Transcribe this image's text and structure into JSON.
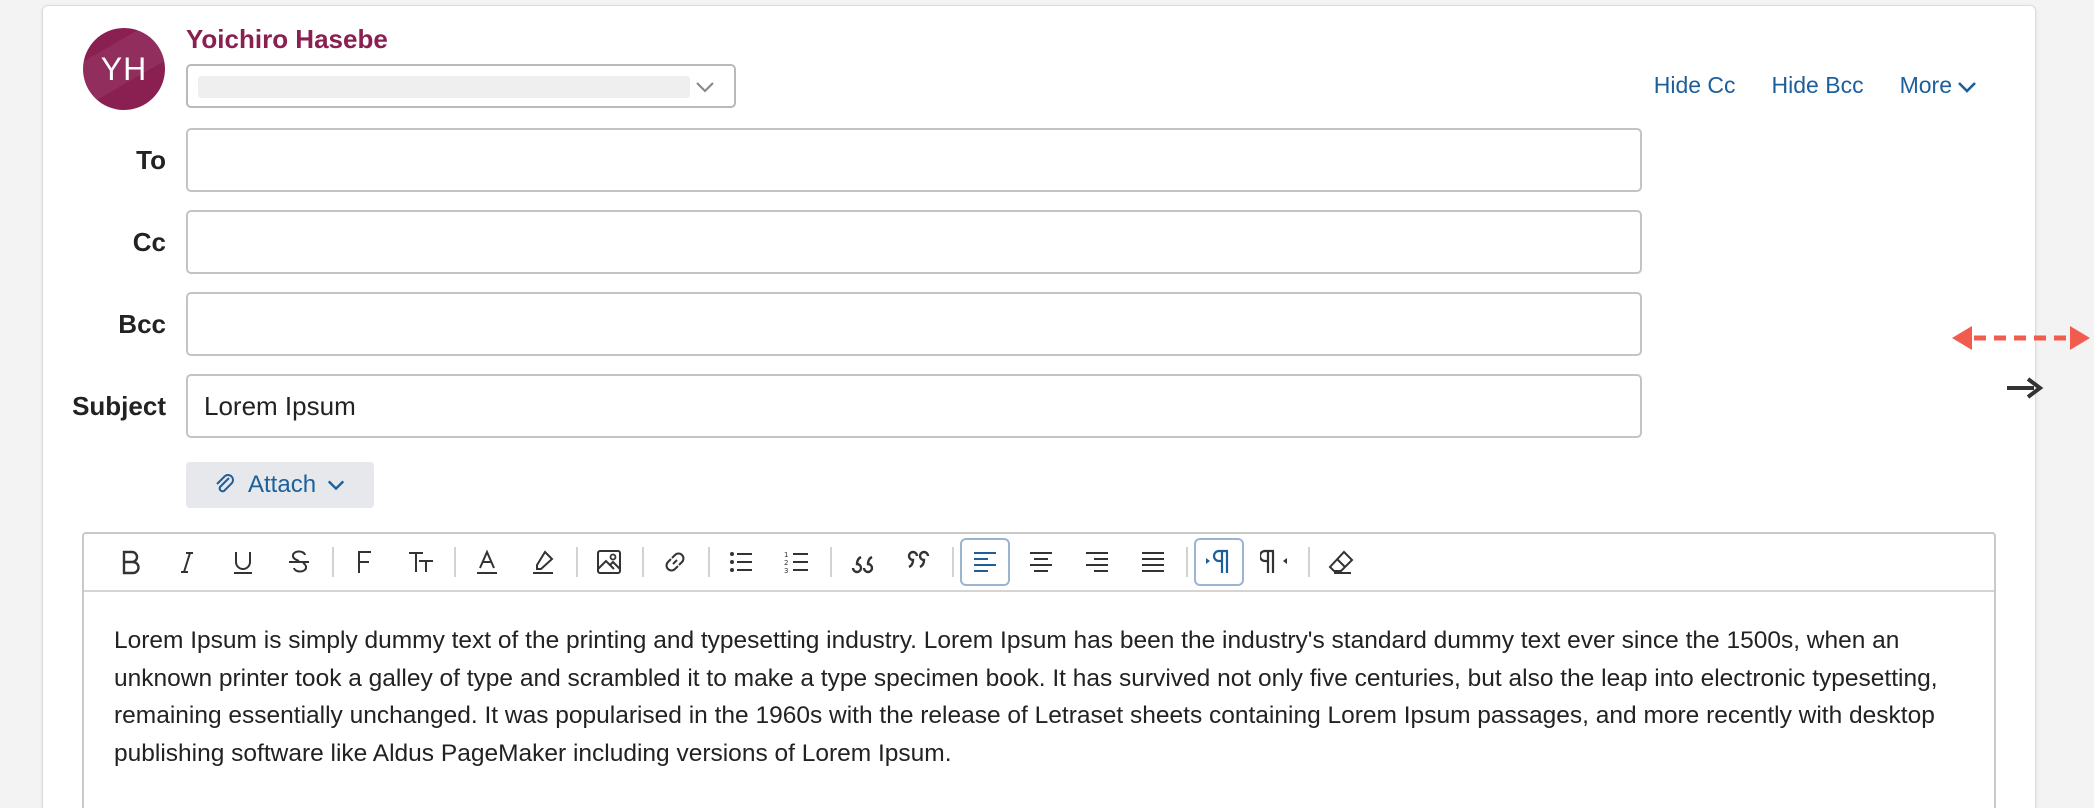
{
  "sender": {
    "initials": "YH",
    "name": "Yoichiro Hasebe",
    "avatar_color": "#8a1f52"
  },
  "from_select": {
    "value": "",
    "icon": "chevron-down-icon"
  },
  "header_links": {
    "hide_cc": "Hide Cc",
    "hide_bcc": "Hide Bcc",
    "more": "More"
  },
  "fields": {
    "to": {
      "label": "To",
      "value": ""
    },
    "cc": {
      "label": "Cc",
      "value": ""
    },
    "bcc": {
      "label": "Bcc",
      "value": ""
    },
    "subject": {
      "label": "Subject",
      "value": "Lorem Ipsum"
    }
  },
  "attach": {
    "label": "Attach",
    "icon": "paperclip-icon"
  },
  "toolbar": {
    "buttons": [
      {
        "name": "bold-icon"
      },
      {
        "name": "italic-icon"
      },
      {
        "name": "underline-icon"
      },
      {
        "name": "strikethrough-icon"
      },
      {
        "name": "font-family-icon"
      },
      {
        "name": "font-size-icon"
      },
      {
        "name": "text-color-icon"
      },
      {
        "name": "highlight-icon"
      },
      {
        "name": "image-icon"
      },
      {
        "name": "link-icon"
      },
      {
        "name": "bulleted-list-icon"
      },
      {
        "name": "numbered-list-icon"
      },
      {
        "name": "blockquote-open-icon"
      },
      {
        "name": "blockquote-close-icon"
      },
      {
        "name": "align-left-icon",
        "active": true
      },
      {
        "name": "align-center-icon"
      },
      {
        "name": "align-right-icon"
      },
      {
        "name": "align-justify-icon"
      },
      {
        "name": "ltr-direction-icon",
        "active": true
      },
      {
        "name": "rtl-direction-icon"
      },
      {
        "name": "clear-formatting-icon"
      }
    ],
    "accent_color": "#1c5f9b"
  },
  "body": {
    "text": "Lorem Ipsum is simply dummy text of the printing and typesetting industry. Lorem Ipsum has been the industry's standard dummy text ever since the 1500s, when an unknown printer took a galley of type and scrambled it to make a type specimen book. It has survived not only five centuries, but also the leap into electronic typesetting, remaining essentially unchanged. It was popularised in the 1960s with the release of Letraset sheets containing Lorem Ipsum passages, and more recently with desktop publishing software like Aldus PageMaker including versions of Lorem Ipsum."
  },
  "resize_indicator": {
    "icon": "resize-arrows-icon",
    "color": "#f25c4f"
  },
  "cursor": {
    "icon": "cursor-arrow-icon"
  }
}
